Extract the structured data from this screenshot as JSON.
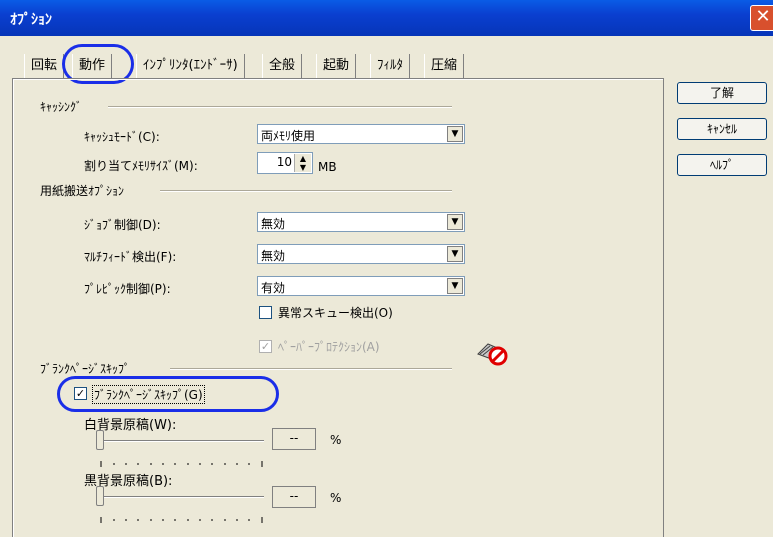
{
  "window": {
    "title": "ｵﾌﾟｼｮﾝ",
    "close": "✕"
  },
  "tabs": [
    {
      "label": "回転"
    },
    {
      "label": "動作"
    },
    {
      "label": "ｲﾝﾌﾟﾘﾝﾀ(ｴﾝﾄﾞｰｻ)"
    },
    {
      "label": "全般"
    },
    {
      "label": "起動"
    },
    {
      "label": "ﾌｨﾙﾀ"
    },
    {
      "label": "圧縮"
    }
  ],
  "buttons": {
    "ok": "了解",
    "cancel": "ｷｬﾝｾﾙ",
    "help": "ﾍﾙﾌﾟ"
  },
  "caching": {
    "section_label": "ｷｬｯｼﾝｸﾞ",
    "mode_label": "ｷｬｯｼｭﾓｰﾄﾞ(C):",
    "mode_value": "両ﾒﾓﾘ使用",
    "memsize_label": "割り当てﾒﾓﾘｻｲｽﾞ(M):",
    "memsize_value": "10",
    "memsize_unit": "MB"
  },
  "feed": {
    "section_label": "用紙搬送ｵﾌﾟｼｮﾝ",
    "job_label": "ｼﾞｮﾌﾞ制御(D):",
    "job_value": "無効",
    "multifeed_label": "ﾏﾙﾁﾌｨｰﾄﾞ検出(F):",
    "multifeed_value": "無効",
    "prepick_label": "ﾌﾟﾚﾋﾟｯｸ制御(P):",
    "prepick_value": "有効",
    "skew_label": "異常スキュー検出(O)",
    "skew_checked": false,
    "protect_label": "ﾍﾟｰﾊﾟｰﾌﾟﾛﾃｸｼｮﾝ(A)",
    "protect_checked": true
  },
  "blank_skip": {
    "section_label": "ﾌﾞﾗﾝｸﾍﾟｰｼﾞｽｷｯﾌﾟ",
    "checkbox_label": "ﾌﾞﾗﾝｸﾍﾟｰｼﾞｽｷｯﾌﾟ(G)",
    "checkbox_checked": true,
    "white_label": "白背景原稿(W):",
    "white_value": "--",
    "white_unit": "%",
    "white_level": 0,
    "black_label": "黒背景原稿(B):",
    "black_value": "--",
    "black_unit": "%",
    "black_level": 0
  }
}
